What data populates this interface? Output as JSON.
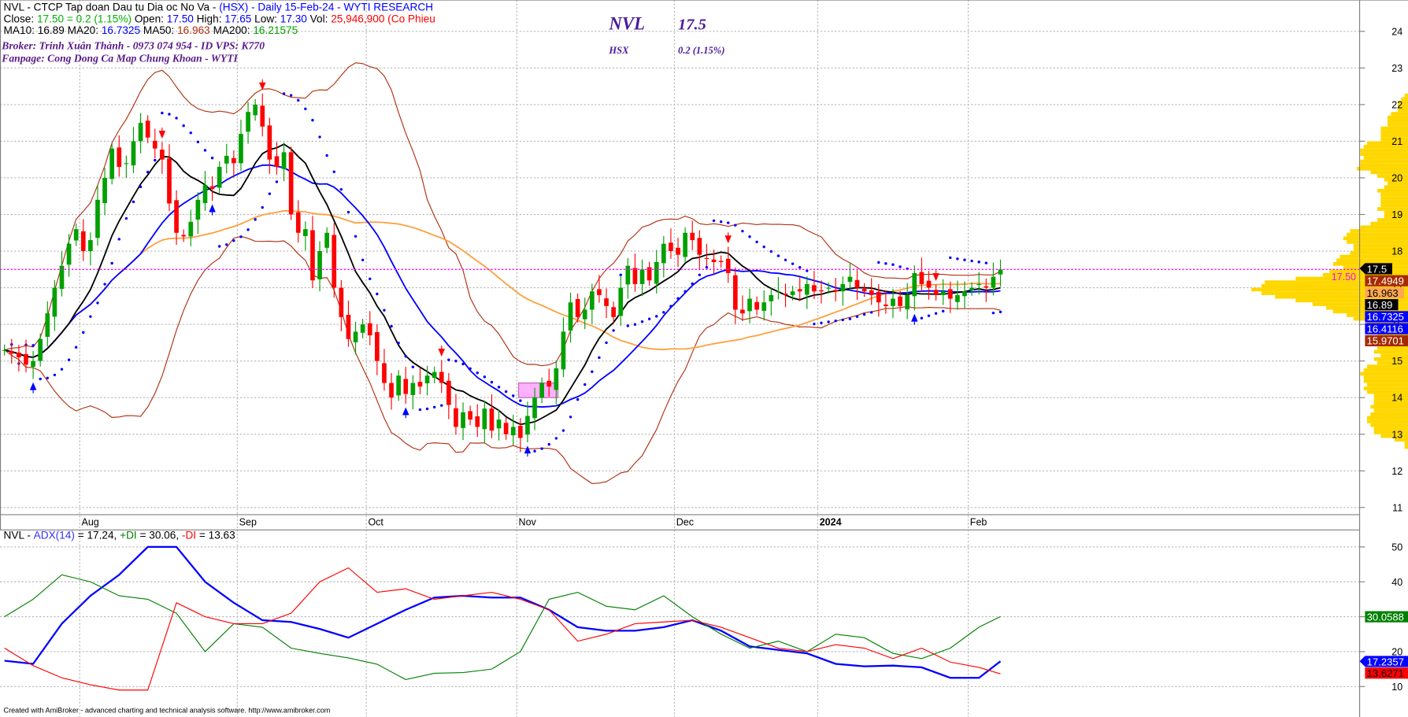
{
  "header": {
    "line1_prefix": "NVL - CTCP Tap doan Dau tu Dia oc No Va - ",
    "line1_suffix": "(HSX) - Daily 15-Feb-24 - WYTI RESEARCH",
    "close_label": "Close:",
    "close_value": "17.50 = 0.2 (1.15%)",
    "open_label": "Open:",
    "open_value": "17.50",
    "high_label": "High:",
    "high_value": "17.65",
    "low_label": "Low:",
    "low_value": "17.30",
    "vol_label": "Vol:",
    "vol_value": "25,946,900 (Co Phieu",
    "ma10_label": "MA10:",
    "ma10_value": "16.89",
    "ma20_label": "MA20:",
    "ma20_value": "16.7325",
    "ma50_label": "MA50:",
    "ma50_value": "16.963",
    "ma200_label": "MA200:",
    "ma200_value": "16.21575",
    "broker": "Broker: Trinh Xuân Thành - 0973 074 954 - ID VPS: K770",
    "fanpage": "Fanpage: Cong Dong Ca Map Chung Khoan - WYTI"
  },
  "overlay": {
    "symbol": "NVL",
    "price": "17.5",
    "exchange": "HSX",
    "change": "0.2 (1.15%)"
  },
  "colors": {
    "up": "#00a000",
    "down": "#ff0000",
    "ma10": "#000000",
    "ma20": "#0000ff",
    "ma50": "#ffa040",
    "bands": "#b03010",
    "sar": "#0000ff",
    "profile": "#ffd700",
    "adx": "#0000ff",
    "plus_di": "#008000",
    "minus_di": "#ff0000",
    "last_price_line": "#ff00ff"
  },
  "chart_data": [
    {
      "type": "candlestick",
      "title": "NVL - CTCP Tap doan Dau tu Dia oc No Va - (HSX) - Daily 15-Feb-24 - WYTI RESEARCH",
      "ylim": [
        10.6,
        24.6
      ],
      "y_ticks": [
        "11",
        "12",
        "13",
        "14",
        "15",
        "16",
        "17",
        "18",
        "19",
        "20",
        "21",
        "22",
        "23",
        "24"
      ],
      "x_month_labels": [
        {
          "label": "Aug",
          "bar": 11
        },
        {
          "label": "Sep",
          "bar": 33
        },
        {
          "label": "Oct",
          "bar": 51
        },
        {
          "label": "Nov",
          "bar": 72
        },
        {
          "label": "Dec",
          "bar": 94
        },
        {
          "label": "2024",
          "bar": 114
        },
        {
          "label": "Feb",
          "bar": 135
        }
      ],
      "close": [
        15.3,
        15.2,
        15.1,
        14.9,
        15.0,
        15.6,
        16.3,
        17.0,
        17.6,
        18.2,
        18.6,
        18.0,
        18.3,
        19.4,
        20.0,
        20.8,
        20.3,
        20.4,
        21.0,
        21.5,
        21.1,
        20.8,
        20.5,
        19.3,
        18.5,
        18.4,
        18.8,
        19.4,
        19.8,
        19.7,
        20.3,
        20.6,
        20.4,
        21.2,
        21.8,
        22.0,
        21.4,
        20.5,
        20.3,
        20.7,
        19.0,
        18.5,
        18.6,
        17.2,
        18.0,
        18.5,
        17.0,
        16.2,
        15.6,
        15.8,
        16.0,
        15.7,
        15.0,
        14.4,
        14.0,
        14.6,
        14.1,
        14.4,
        14.3,
        14.6,
        14.7,
        14.4,
        13.8,
        13.2,
        13.6,
        13.4,
        13.2,
        13.7,
        13.1,
        13.4,
        13.0,
        13.2,
        12.9,
        13.5,
        14.0,
        14.4,
        14.3,
        14.8,
        15.8,
        16.6,
        16.2,
        16.4,
        16.9,
        16.8,
        16.5,
        16.2,
        17.0,
        17.6,
        17.1,
        17.5,
        17.2,
        17.7,
        18.2,
        18.0,
        17.9,
        18.5,
        18.3,
        17.9,
        17.8,
        17.7,
        17.7,
        17.4,
        16.4,
        16.3,
        16.7,
        16.4,
        16.6,
        16.8,
        16.9,
        16.8,
        16.9,
        16.9,
        17.1,
        16.9,
        16.9,
        17.0,
        16.9,
        17.1,
        17.3,
        17.0,
        16.9,
        16.8,
        16.6,
        16.5,
        16.7,
        16.5,
        16.8,
        17.4,
        17.1,
        17.0,
        16.8,
        16.9,
        16.7,
        16.8,
        16.9,
        17.0,
        17.1,
        17.0,
        17.3,
        17.5
      ],
      "signals": {
        "buy": [
          4,
          29,
          56,
          73,
          127
        ],
        "sell": [
          22,
          36,
          61,
          101,
          130
        ]
      },
      "highlight_zone": {
        "bar_from": 72,
        "bar_to": 77,
        "price_low": 14.0,
        "price_high": 14.4
      },
      "last_price": "17.50",
      "right_labels": [
        {
          "text": "17.5",
          "bg": "#000000",
          "fg": "#ffffff"
        },
        {
          "text": "17.4949",
          "bg": "#a52a00",
          "fg": "#ffffff"
        },
        {
          "text": "16.963",
          "bg": "#ffa850",
          "fg": "#000000"
        },
        {
          "text": "16.89",
          "bg": "#000000",
          "fg": "#ffffff"
        },
        {
          "text": "16.7325",
          "bg": "#0000ff",
          "fg": "#ffffff"
        },
        {
          "text": "16.4116",
          "bg": "#0000ff",
          "fg": "#ffffff"
        },
        {
          "text": "15.9701",
          "bg": "#a52a00",
          "fg": "#ffffff"
        }
      ]
    },
    {
      "type": "line",
      "title_prefix": "NVL - ",
      "title_adx": "ADX(14)",
      "title_mid1": " = 17.24, ",
      "title_pdi": "+DI",
      "title_mid2": " = 30.06, ",
      "title_mdi": "-DI",
      "title_end": " = 13.63",
      "ylim": [
        6,
        54
      ],
      "y_ticks": [
        "10",
        "20",
        "40",
        "50"
      ],
      "x_bars": [
        0,
        4,
        8,
        12,
        16,
        20,
        24,
        28,
        32,
        36,
        40,
        44,
        48,
        52,
        56,
        60,
        64,
        68,
        72,
        76,
        80,
        84,
        88,
        92,
        96,
        100,
        104,
        108,
        112,
        116,
        120,
        124,
        128,
        132,
        136,
        139
      ],
      "series": [
        {
          "name": "ADX(14)",
          "values": [
            17.4,
            16.5,
            28,
            36,
            42,
            50,
            50,
            40,
            34,
            29,
            28.5,
            26.5,
            24,
            28,
            32,
            35.5,
            36,
            35.5,
            35.5,
            32,
            27,
            26,
            26,
            27,
            29,
            26,
            21.5,
            20.5,
            19.5,
            16.5,
            15.8,
            16,
            15.5,
            12.5,
            12.5,
            17.24
          ]
        },
        {
          "name": "+DI",
          "values": [
            30,
            35,
            42,
            40,
            36,
            35,
            31,
            20,
            28,
            27,
            21,
            19.5,
            18.2,
            16.4,
            12,
            13.8,
            14,
            15,
            20,
            35,
            37,
            33,
            32,
            36,
            30,
            25,
            21,
            23,
            20,
            25,
            24,
            19.5,
            18,
            21,
            27,
            30.06
          ]
        },
        {
          "name": "-DI",
          "values": [
            21,
            16,
            12.5,
            10.5,
            9,
            9,
            34,
            30,
            28,
            28,
            31,
            40,
            44,
            37,
            38,
            35,
            36,
            37,
            35,
            32,
            23,
            25,
            28,
            28.5,
            29,
            27,
            24,
            21,
            20,
            22,
            21,
            18,
            21,
            17,
            15.5,
            13.63
          ]
        }
      ],
      "right_labels": [
        {
          "text": "30.0588",
          "bg": "#008000",
          "fg": "#ffffff",
          "value": 30.06
        },
        {
          "text": "17.2357",
          "bg": "#0000ff",
          "fg": "#ffffff",
          "value": 17.24
        },
        {
          "text": "13.6271",
          "bg": "#ff0000",
          "fg": "#000000",
          "value": 13.63
        }
      ]
    }
  ],
  "footer": "Created with AmiBroker - advanced charting and technical analysis software. http://www.amibroker.com"
}
